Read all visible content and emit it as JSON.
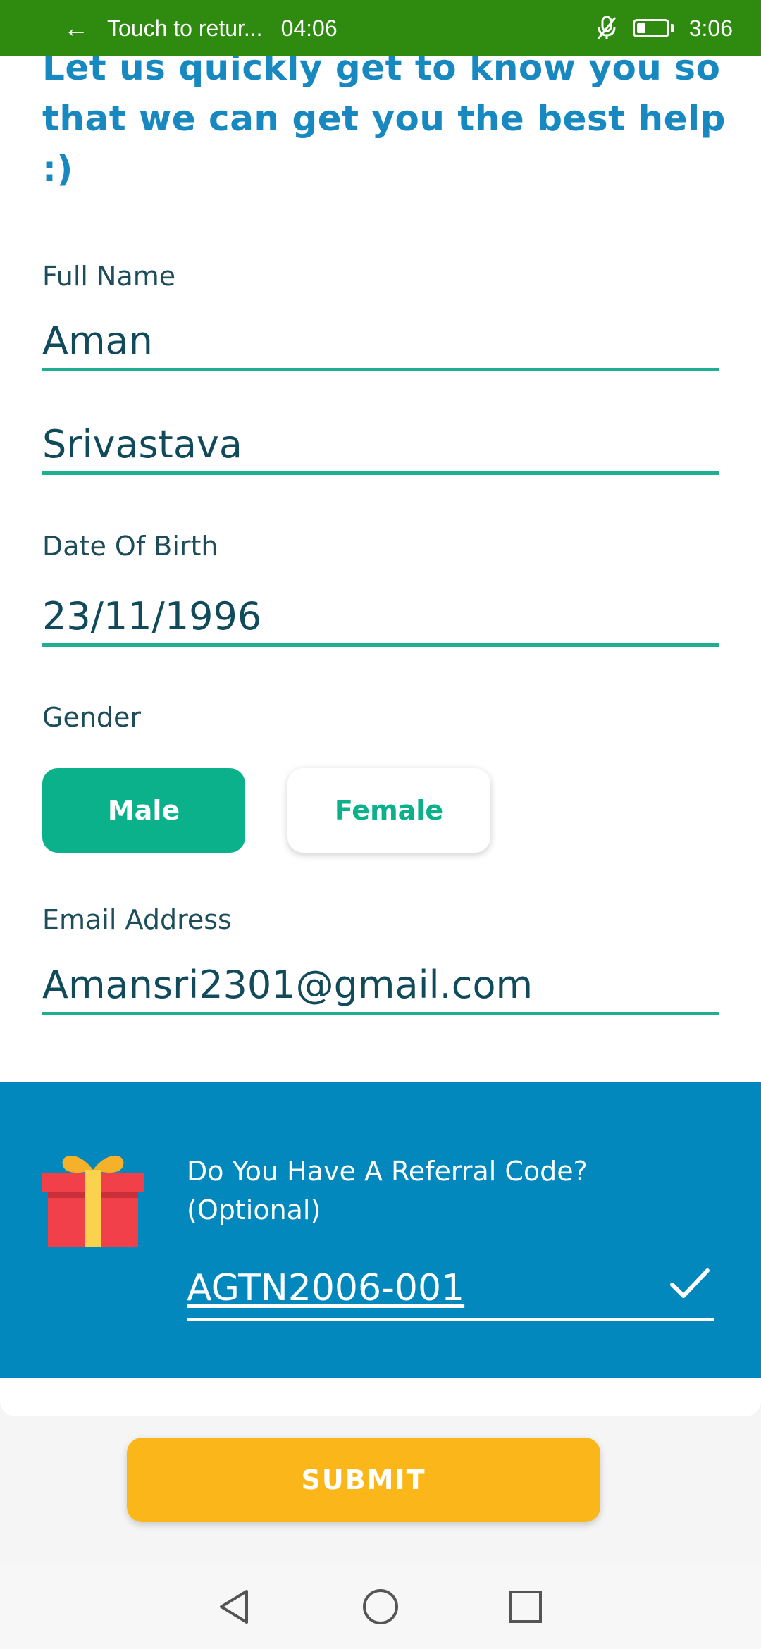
{
  "status_bar": {
    "back_arrow": "←",
    "call_text": "Touch to retur...",
    "call_timer": "04:06",
    "clock": "3:06",
    "icons": [
      "back-arrow-icon",
      "mic-off-icon",
      "battery-icon"
    ],
    "background_color": "#2f8b10"
  },
  "intro": {
    "text": "Let us quickly get to know you so that we can get you the best help :)"
  },
  "form": {
    "full_name_label": "Full Name",
    "first_name": "Aman",
    "last_name": "Srivastava",
    "dob_label": "Date Of Birth",
    "dob": "23/11/1996",
    "gender_label": "Gender",
    "gender_options": [
      "Male",
      "Female"
    ],
    "gender_selected": "Male",
    "email_label": "Email Address",
    "email": "Amansri2301@gmail.com",
    "accent_color": "#0ab18a"
  },
  "referral": {
    "label": "Do You Have A Referral Code? (Optional)",
    "code": "AGTN2006-001",
    "icons": [
      "gift-icon",
      "check-icon"
    ],
    "panel_color": "#0388bd"
  },
  "submit": {
    "label": "SUBMIT",
    "color": "#fbb71a"
  },
  "nav_bar": {
    "icons": [
      "back-triangle-icon",
      "home-circle-icon",
      "recents-square-icon"
    ]
  }
}
